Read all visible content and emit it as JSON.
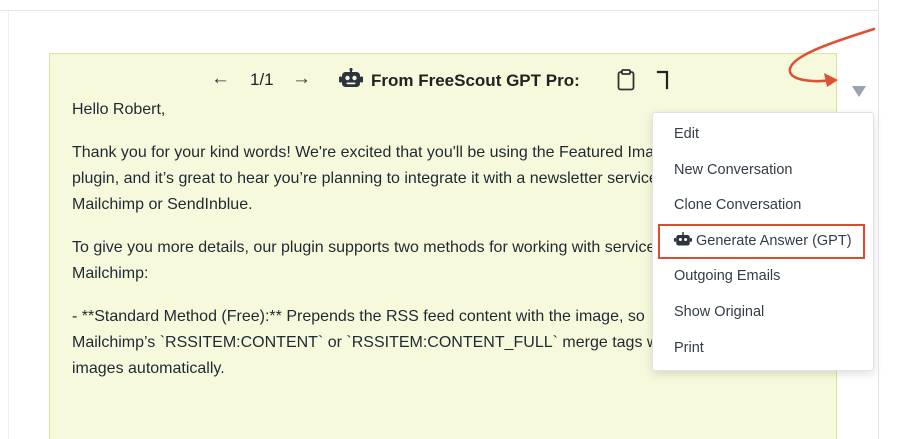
{
  "gpt_header": {
    "prev_arrow": "←",
    "counter": "1/1",
    "next_arrow": "→",
    "title": "From FreeScout GPT Pro:",
    "robot_icon": "robot-icon",
    "copy_icon": "clipboard-icon",
    "insert_icon": "corner-insert-icon"
  },
  "answer": {
    "paragraphs": [
      "Hello Robert,",
      "Thank you for your kind words! We're excited that you'll be using the Featured Image in RSS",
      "plugin, and it’s great to hear you’re planning to integrate it with a newsletter service like",
      "Mailchimp or SendInblue.",
      "To give you more details, our plugin supports two methods for working with services like",
      "Mailchimp:",
      "- **Standard Method (Free):** Prepends the RSS feed content with the image, so",
      "Mailchimp’s `RSSITEM:CONTENT` or `RSSITEM:CONTENT_FULL` merge tags will display",
      "images automatically."
    ]
  },
  "menu": {
    "items": [
      {
        "label": "Edit"
      },
      {
        "label": "New Conversation"
      },
      {
        "label": "Clone Conversation"
      },
      {
        "label": "Generate Answer (GPT)",
        "icon": "robot-icon"
      },
      {
        "label": "Outgoing Emails"
      },
      {
        "label": "Show Original"
      },
      {
        "label": "Print"
      }
    ]
  },
  "colors": {
    "answer_bg": "#f7f9dc",
    "highlight": "#dc4a2f",
    "annotation_arrow": "#e05034"
  }
}
